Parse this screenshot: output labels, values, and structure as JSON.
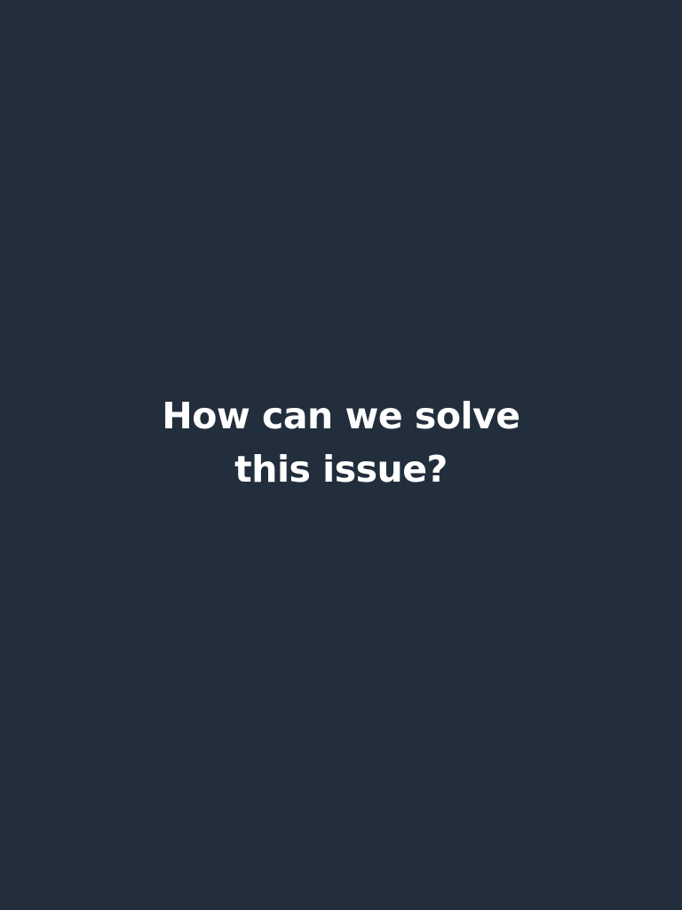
{
  "colors": {
    "background": "#222e3c",
    "text": "#ffffff"
  },
  "message": {
    "line1": "How can we solve",
    "line2": "this issue?"
  }
}
